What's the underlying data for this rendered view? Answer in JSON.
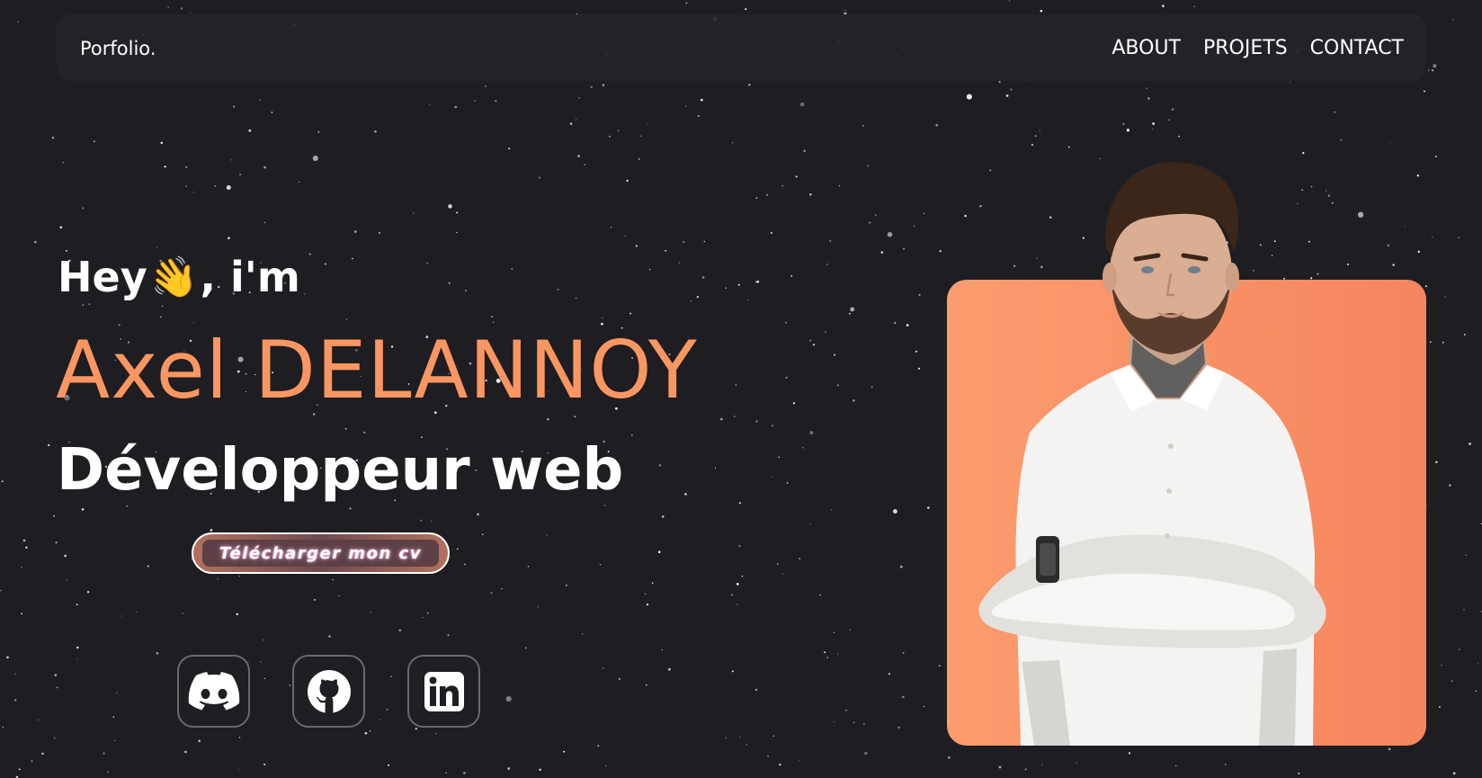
{
  "nav": {
    "brand": "Porfolio.",
    "links": [
      {
        "label": "ABOUT"
      },
      {
        "label": "PROJETS"
      },
      {
        "label": "CONTACT"
      }
    ]
  },
  "hero": {
    "greeting_prefix": "Hey",
    "wave_emoji": "👋",
    "greeting_suffix": ", i'm",
    "name": "Axel DELANNOY",
    "role": "Développeur web",
    "cv_button": "Télécharger mon cv"
  },
  "socials": [
    {
      "icon": "discord-icon"
    },
    {
      "icon": "github-icon"
    },
    {
      "icon": "linkedin-icon"
    }
  ],
  "colors": {
    "background": "#1e1d22",
    "accent": "#fa9661",
    "card_gradient_start": "#fb9d6e",
    "card_gradient_end": "#f6855d",
    "text": "#ffffff"
  }
}
